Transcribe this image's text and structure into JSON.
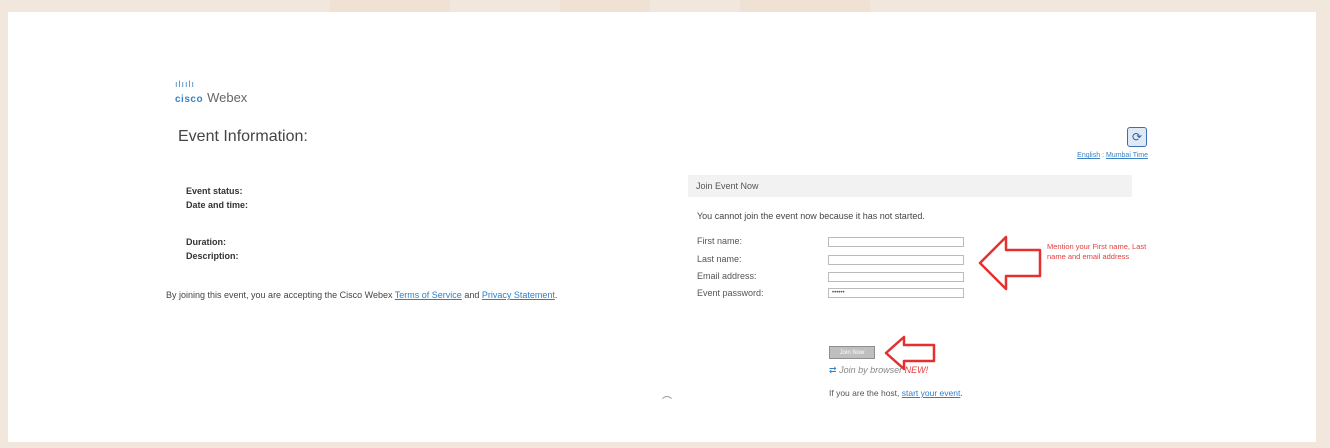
{
  "logo": {
    "cisco": "cisco",
    "product": "Webex"
  },
  "event": {
    "title": "Event Information:",
    "fields": [
      "Event status:",
      "Date and time:",
      "Duration:",
      "Description:"
    ]
  },
  "toplinks": {
    "language": "English",
    "separator": " : ",
    "timezone": "Mumbai Time"
  },
  "terms": {
    "prefix": "By joining this event, you are accepting the Cisco Webex ",
    "tos_link": "Terms of Service",
    "middle": " and ",
    "privacy_link": "Privacy Statement",
    "suffix": "."
  },
  "join": {
    "header": "Join Event Now",
    "notice": "You cannot join the event now because it has not started.",
    "first_name_label": "First name:",
    "last_name_label": "Last name:",
    "email_label": "Email address:",
    "password_label": "Event password:",
    "password_value": "••••••",
    "join_button": "Join Now",
    "browser_link": "Join by browser",
    "browser_new": "NEW!",
    "host_prefix": "If you are the host, ",
    "host_link": "start your event",
    "host_suffix": "."
  },
  "annotation": {
    "text": "Mention your First name, Last name and email address"
  },
  "colors": {
    "accent": "#3b82c4",
    "annotation": "#e34040",
    "background": "#f1e7dd"
  }
}
